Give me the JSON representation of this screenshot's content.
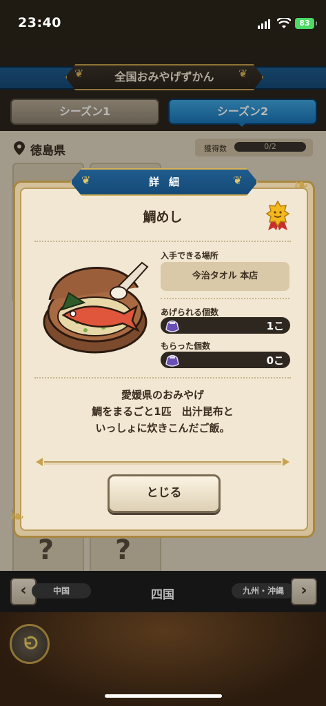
{
  "status_bar": {
    "time": "23:40",
    "battery": "83"
  },
  "header": {
    "title": "全国おみやげずかん"
  },
  "tabs": [
    {
      "label": "シーズン1",
      "selected": false
    },
    {
      "label": "シーズン2",
      "selected": true
    }
  ],
  "collection": {
    "prefecture": "徳島県",
    "count_label": "獲得数",
    "count_value": "0/2",
    "unknown_mark": "?"
  },
  "bottom_nav": {
    "prev_label": "中国",
    "current_label": "四国",
    "next_label": "九州・沖縄",
    "prev_arrow": "‹",
    "next_arrow": "›"
  },
  "modal": {
    "title": "詳細",
    "item_name": "鯛めし",
    "obtain_location_label": "入手できる場所",
    "obtain_location_value": "今治タオル 本店",
    "giveable_label": "あげられる個数",
    "giveable_value": "1こ",
    "received_label": "もらった個数",
    "received_value": "0こ",
    "description": [
      "愛媛県のおみやげ",
      "鯛をまるごと1匹　出汁昆布と",
      "いっしょに炊きこんだご飯。"
    ],
    "close_label": "とじる"
  },
  "colors": {
    "accent_blue": "#1a76b9",
    "gold": "#c9a24d",
    "parchment": "#f1e7d2",
    "text_dark": "#3a2d20"
  },
  "icons": [
    "location-pin-icon",
    "medal-icon",
    "gift-bag-icon",
    "back-arrow-icon",
    "signal-icon",
    "wifi-icon",
    "battery-icon"
  ]
}
